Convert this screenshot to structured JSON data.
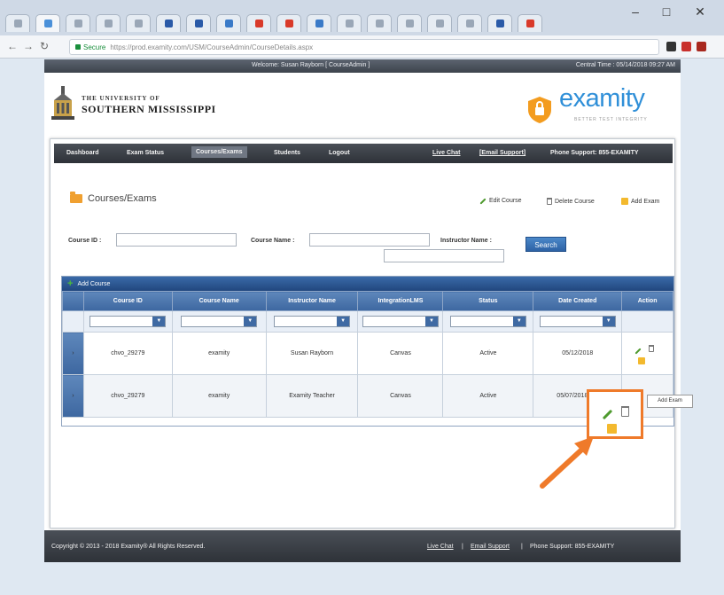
{
  "browser": {
    "window_controls": [
      "–",
      "□",
      "✕"
    ],
    "url_secure_label": "Secure",
    "url": "https://prod.examity.com/USM/CourseAdmin/CourseDetails.aspx",
    "tab_colors": [
      "#9aa7b7",
      "#4a90d9",
      "#9aa7b7",
      "#9aa7b7",
      "#9aa7b7",
      "#2a5aa8",
      "#2a5aa8",
      "#3a7ac8",
      "#d93a2a",
      "#d93a2a",
      "#3a7ac8",
      "#9aa7b7",
      "#9aa7b7",
      "#9aa7b7",
      "#9aa7b7",
      "#9aa7b7",
      "#2a5aa8",
      "#d93a2a"
    ]
  },
  "top_strip": {
    "welcome": "Welcome: Susan Rayborn [ CourseAdmin ]",
    "central_time": "Central Time : 05/14/2018 09:27 AM"
  },
  "usm_logo": {
    "line1": "THE UNIVERSITY OF",
    "line2": "SOUTHERN MISSISSIPPI"
  },
  "examity_logo": {
    "word": "examity",
    "tagline": "BETTER TEST INTEGRITY"
  },
  "main_nav": {
    "dashboard": "Dashboard",
    "exam_status": "Exam Status",
    "courses_exams": "Courses/Exams",
    "students": "Students",
    "logout": "Logout",
    "live_chat": "Live Chat",
    "email_support": "[Email Support]",
    "phone_support": "Phone Support: 855-EXAMITY"
  },
  "section_title": "Courses/Exams",
  "top_actions": {
    "edit_course": "Edit Course",
    "delete_course": "Delete Course",
    "add_exam": "Add Exam"
  },
  "search": {
    "course_id_label": "Course ID :",
    "course_name_label": "Course Name :",
    "instructor_name_label": "Instructor Name :",
    "search_button": "Search"
  },
  "grid": {
    "add_course": "Add Course",
    "columns": [
      "Course ID",
      "Course Name",
      "Instructor Name",
      "IntegrationLMS",
      "Status",
      "Date Created",
      "Action"
    ],
    "rows": [
      {
        "course_id": "chvo_29279",
        "course_name": "examity",
        "instructor": "Susan Rayborn",
        "lms": "Canvas",
        "status": "Active",
        "date_created": "05/12/2018"
      },
      {
        "course_id": "chvo_29279",
        "course_name": "examity",
        "instructor": "Examity Teacher",
        "lms": "Canvas",
        "status": "Active",
        "date_created": "05/07/2018"
      }
    ]
  },
  "tooltip": "Add Exam",
  "footer": {
    "copyright": "Copyright © 2013 - 2018 Examity® All Rights Reserved.",
    "live_chat": "Live Chat",
    "email_support": "Email Support",
    "phone_support": "Phone Support: 855-EXAMITY",
    "separator": "|"
  }
}
